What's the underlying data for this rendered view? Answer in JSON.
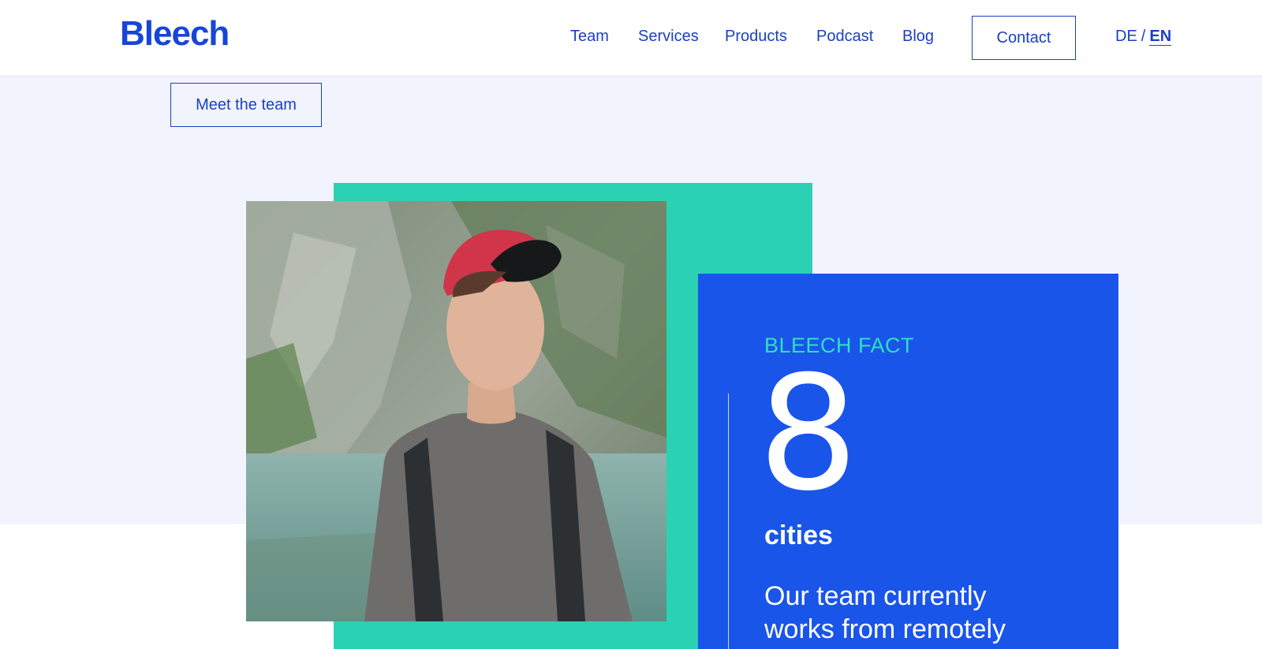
{
  "header": {
    "logo": "Bleech",
    "nav": [
      "Team",
      "Services",
      "Products",
      "Podcast",
      "Blog"
    ],
    "contact_label": "Contact",
    "lang": {
      "de": "DE",
      "separator": "/",
      "en": "EN",
      "active": "EN"
    }
  },
  "hero": {
    "meet_button": "Meet the team"
  },
  "fact": {
    "label": "BLEECH FACT",
    "number": "8",
    "unit": "cities",
    "text": "Our team currently works from remotely"
  },
  "colors": {
    "brand_blue": "#1a55ea",
    "teal": "#2bd1b3",
    "band": "#f1f4fc"
  }
}
